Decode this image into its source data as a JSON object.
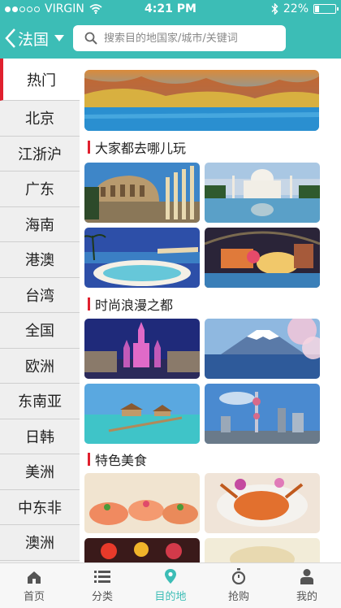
{
  "status": {
    "carrier": "VIRGIN",
    "time": "4:21 PM",
    "battery": "22%",
    "battery_level": 0.22
  },
  "header": {
    "country": "法国",
    "search_placeholder": "搜索目的地国家/城市/关键词"
  },
  "sidebar": {
    "items": [
      {
        "label": "热门",
        "active": true
      },
      {
        "label": "北京"
      },
      {
        "label": "江浙沪"
      },
      {
        "label": "广东"
      },
      {
        "label": "海南"
      },
      {
        "label": "港澳"
      },
      {
        "label": "台湾"
      },
      {
        "label": "全国"
      },
      {
        "label": "欧洲"
      },
      {
        "label": "东南亚"
      },
      {
        "label": "日韩"
      },
      {
        "label": "美洲"
      },
      {
        "label": "中东非"
      },
      {
        "label": "澳洲"
      }
    ]
  },
  "sections": {
    "s1": {
      "title": "大家都去哪儿玩"
    },
    "s2": {
      "title": "时尚浪漫之都"
    },
    "s3": {
      "title": "特色美食"
    }
  },
  "tabbar": {
    "items": [
      {
        "label": "首页"
      },
      {
        "label": "分类"
      },
      {
        "label": "目的地",
        "active": true
      },
      {
        "label": "抢购"
      },
      {
        "label": "我的"
      }
    ]
  },
  "colors": {
    "accent": "#3cbdb6",
    "section_bar": "#e0202e"
  }
}
